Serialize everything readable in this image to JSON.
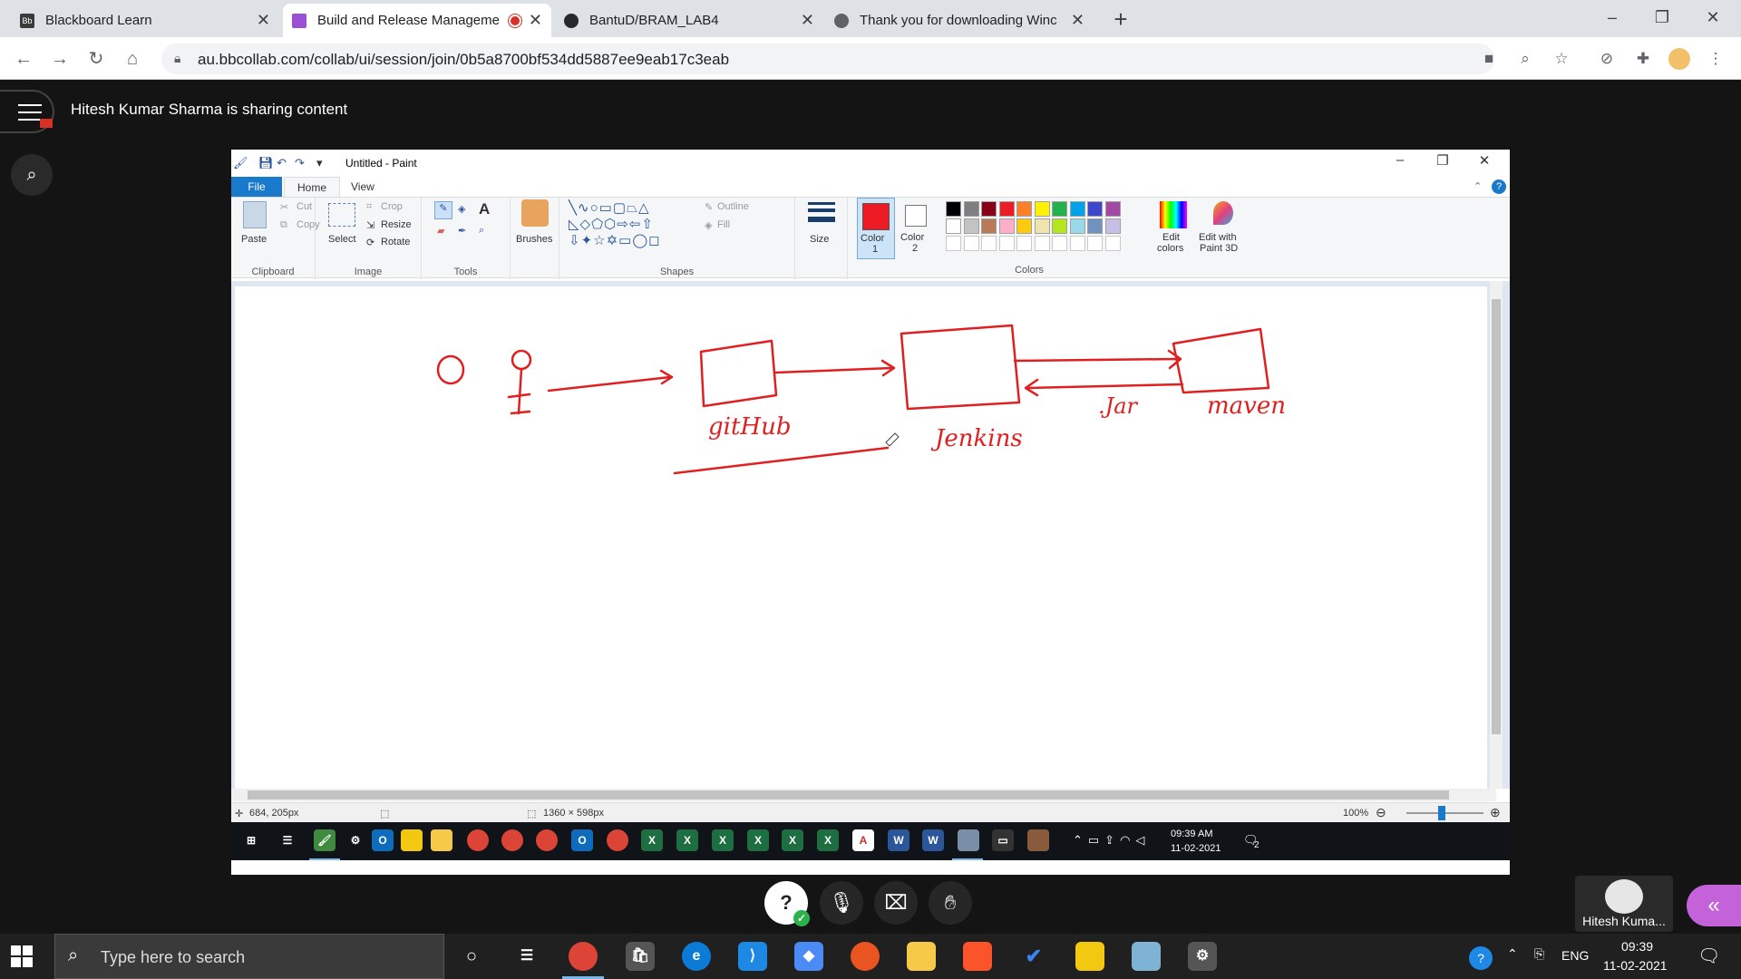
{
  "browser": {
    "tabs": [
      {
        "label": "Blackboard Learn",
        "fav": "#3a3a3a",
        "active": false
      },
      {
        "label": "Build and Release Manageme",
        "fav": "#9b4fd4",
        "active": true,
        "recording": true
      },
      {
        "label": "BantuD/BRAM_LAB4",
        "fav": "#24292e",
        "active": false
      },
      {
        "label": "Thank you for downloading Winc",
        "fav": "#5f6368",
        "active": false
      }
    ],
    "url": "au.bbcollab.com/collab/ui/session/join/0b5a8700bf534dd5887ee9eab17c3eab"
  },
  "collab": {
    "sharing_text": "Hitesh Kumar Sharma is sharing content",
    "participant_name": "Hitesh Kuma..."
  },
  "paint": {
    "window_title": "Untitled - Paint",
    "tabs": {
      "file": "File",
      "home": "Home",
      "view": "View"
    },
    "clipboard": {
      "paste": "Paste",
      "cut": "Cut",
      "copy": "Copy",
      "group": "Clipboard"
    },
    "image": {
      "select": "Select",
      "crop": "Crop",
      "resize": "Resize",
      "rotate": "Rotate",
      "group": "Image"
    },
    "tools": {
      "group": "Tools",
      "text_tool": "A"
    },
    "brushes": "Brushes",
    "shapes": {
      "outline": "Outline",
      "fill": "Fill",
      "group": "Shapes"
    },
    "size": "Size",
    "color1": {
      "label": "Color",
      "num": "1",
      "value": "#ed1c24"
    },
    "color2": {
      "label": "Color",
      "num": "2",
      "value": "#ffffff"
    },
    "colors_group": "Colors",
    "edit_colors": {
      "line1": "Edit",
      "line2": "colors"
    },
    "edit_paint3d": {
      "line1": "Edit with",
      "line2": "Paint 3D"
    },
    "palette": [
      "#000000",
      "#7f7f7f",
      "#880015",
      "#ed1c24",
      "#ff7f27",
      "#fff200",
      "#22b14c",
      "#00a2e8",
      "#3f48cc",
      "#a349a4",
      "#ffffff",
      "#c3c3c3",
      "#b97a57",
      "#ffaec9",
      "#ffc90e",
      "#efe4b0",
      "#b5e61d",
      "#99d9ea",
      "#7092be",
      "#c8bfe7"
    ],
    "drawing": {
      "labels": {
        "github": "gitHub",
        "jenkins": "Jenkins",
        "jar": ".Jar",
        "maven": "maven"
      }
    },
    "status": {
      "cursor_pos": "684, 205px",
      "canvas_size": "1360 × 598px",
      "zoom": "100%"
    }
  },
  "shared_taskbar": {
    "time": "09:39 AM",
    "date": "11-02-2021",
    "notif_count": "2"
  },
  "taskbar": {
    "search_placeholder": "Type here to search",
    "language": "ENG",
    "time": "09:39",
    "date": "11-02-2021"
  }
}
